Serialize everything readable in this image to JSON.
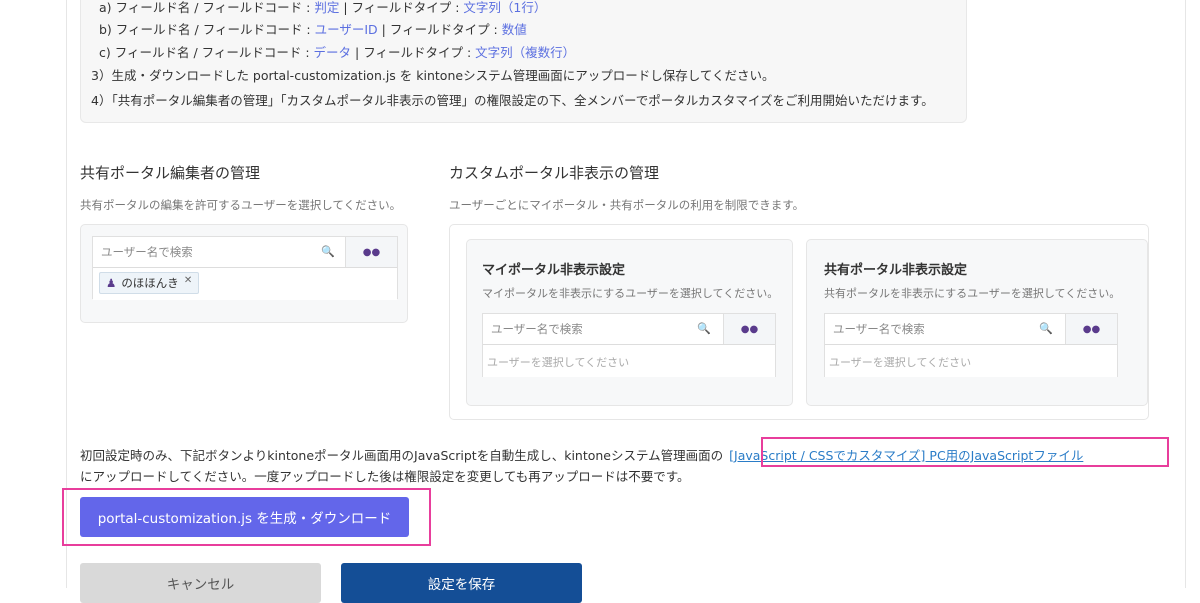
{
  "instructions": {
    "line_a": {
      "prefix": "a) フィールド名 / フィールドコード : ",
      "code": "判定",
      "sep": " | フィールドタイプ : ",
      "type": "文字列（1行）"
    },
    "line_b": {
      "prefix": "b) フィールド名 / フィールドコード : ",
      "code": "ユーザーID",
      "sep": " | フィールドタイプ : ",
      "type": "数値"
    },
    "line_c": {
      "prefix": "c) フィールド名 / フィールドコード : ",
      "code": "データ",
      "sep": " | フィールドタイプ : ",
      "type": "文字列（複数行）"
    },
    "step3": "3）生成・ダウンロードした portal-customization.js を kintoneシステム管理画面にアップロードし保存してください。",
    "step4": "4）「共有ポータル編集者の管理」「カスタムポータル非表示の管理」の権限設定の下、全メンバーでポータルカスタマイズをご利用開始いただけます。"
  },
  "editors": {
    "title": "共有ポータル編集者の管理",
    "desc": "共有ポータルの編集を許可するユーザーを選択してください。",
    "search_placeholder": "ユーザー名で検索",
    "selected": [
      "のほほんき"
    ]
  },
  "hide": {
    "title": "カスタムポータル非表示の管理",
    "desc": "ユーザーごとにマイポータル・共有ポータルの利用を制限できます。",
    "my": {
      "title": "マイポータル非表示設定",
      "desc": "マイポータルを非表示にするユーザーを選択してください。",
      "search_placeholder": "ユーザー名で検索",
      "empty": "ユーザーを選択してください"
    },
    "shared": {
      "title": "共有ポータル非表示設定",
      "desc": "共有ポータルを非表示にするユーザーを選択してください。",
      "search_placeholder": "ユーザー名で検索",
      "empty": "ユーザーを選択してください"
    }
  },
  "note": {
    "text1": "初回設定時のみ、下記ボタンよりkintoneポータル画面用のJavaScriptを自動生成し、kintoneシステム管理画面の",
    "link": "[JavaScript / CSSでカスタマイズ] PC用のJavaScriptファイル",
    "text2": "にアップロードしてください。一度アップロードした後は権限設定を変更しても再アップロードは不要です。"
  },
  "buttons": {
    "generate": "portal-customization.js を生成・ダウンロード",
    "cancel": "キャンセル",
    "save": "設定を保存"
  },
  "colors": {
    "accent": "#6366ea",
    "save": "#144e96",
    "highlight": "#e83e9c"
  }
}
